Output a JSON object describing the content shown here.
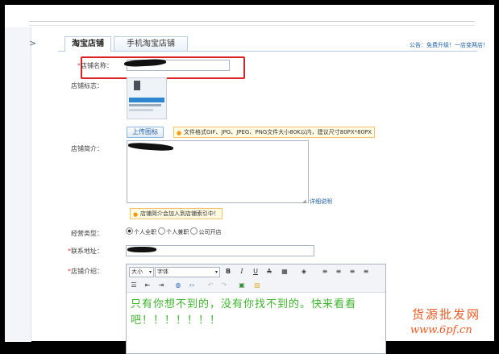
{
  "sidebar": {
    "collapse_icon": ">"
  },
  "tabs": [
    {
      "label": "淘宝店铺",
      "active": true
    },
    {
      "label": "手机淘宝店铺",
      "active": false
    }
  ],
  "notice": "公告：免费升级！一店变两店！",
  "form": {
    "shop_name": {
      "required": "*",
      "label": "店铺名称："
    },
    "shop_logo": {
      "label": "店铺标志：",
      "upload_button": "上传图标",
      "tip": "文件格式GIF、JPG、JPEG、PNG文件大小80K以内，建议尺寸80PX*80PX"
    },
    "shop_intro": {
      "label": "店铺简介：",
      "detail_link": "详细说明",
      "tip": "店铺简介会加入到店铺索引中！"
    },
    "business_type": {
      "label": "经营类型：",
      "options": [
        {
          "label": "个人全职",
          "checked": true
        },
        {
          "label": "个人兼职",
          "checked": false
        },
        {
          "label": "公司开店",
          "checked": false
        }
      ]
    },
    "contact_address": {
      "required": "*",
      "label": "联系地址："
    },
    "shop_description": {
      "required": "*",
      "label": "店铺介绍：",
      "toolbar": {
        "size_label": "大小",
        "font_label": "字体"
      },
      "content": "只有你想不到的，没有你找不到的。快来看看吧！！！！！！！"
    }
  },
  "watermark": {
    "line1": "货源批发网",
    "line2": "www.6pf.cn"
  },
  "colors": {
    "accent_link": "#1f5fa8",
    "required": "#e4393c",
    "highlight_box": "#dd2222",
    "editor_text": "#3fb52e",
    "watermark": "#f05a24"
  }
}
